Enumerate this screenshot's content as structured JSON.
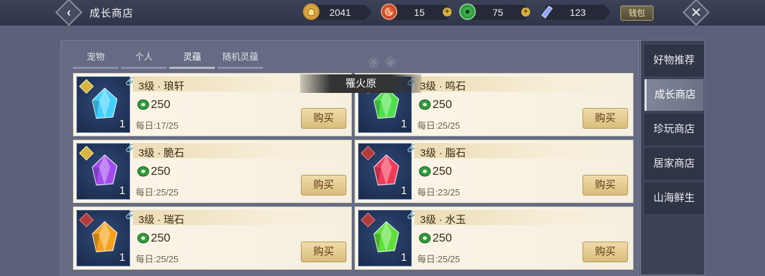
{
  "header": {
    "title": "成长商店",
    "wallet_label": "钱包",
    "resources": [
      {
        "icon": "gold-pouch-icon",
        "value": "2041",
        "color": "#d9a032"
      },
      {
        "icon": "red-coin-icon",
        "value": "15",
        "color": "#c8402a"
      },
      {
        "icon": "jade-coin-icon",
        "value": "75",
        "color": "#2f9a3c"
      },
      {
        "icon": "spirit-crystal-icon",
        "value": "123",
        "color": "#6f8ad6"
      }
    ]
  },
  "tabs": [
    {
      "label": "宠物",
      "active": false
    },
    {
      "label": "个人",
      "active": false
    },
    {
      "label": "灵蕴",
      "active": true
    },
    {
      "label": "随机灵蕴",
      "active": false
    }
  ],
  "tooltip": "罹火原",
  "items": [
    {
      "name": "3级 · 琅轩",
      "price": "250",
      "qty": "1",
      "daily": "每日:17/25",
      "buy": "购买",
      "gem_color": "#3fd0ff",
      "badge": "gold"
    },
    {
      "name": "3级 · 鸣石",
      "price": "250",
      "qty": "1",
      "daily": "每日:25/25",
      "buy": "购买",
      "gem_color": "#4fe04a",
      "badge": "gold"
    },
    {
      "name": "3级 · 脆石",
      "price": "250",
      "qty": "1",
      "daily": "每日:25/25",
      "buy": "购买",
      "gem_color": "#a24cf0",
      "badge": "gold"
    },
    {
      "name": "3级 · 脂石",
      "price": "250",
      "qty": "1",
      "daily": "每日:23/25",
      "buy": "购买",
      "gem_color": "#f03a5a",
      "badge": "red"
    },
    {
      "name": "3级 · 瑞石",
      "price": "250",
      "qty": "1",
      "daily": "每日:25/25",
      "buy": "购买",
      "gem_color": "#f5a21c",
      "badge": "red"
    },
    {
      "name": "3级 · 水玉",
      "price": "250",
      "qty": "1",
      "daily": "每日:25/25",
      "buy": "购买",
      "gem_color": "#5fe03a",
      "badge": "red"
    }
  ],
  "side_nav": [
    {
      "label": "好物推荐",
      "active": false
    },
    {
      "label": "成长商店",
      "active": true
    },
    {
      "label": "珍玩商店",
      "active": false
    },
    {
      "label": "居家商店",
      "active": false
    },
    {
      "label": "山海鲜生",
      "active": false
    }
  ]
}
